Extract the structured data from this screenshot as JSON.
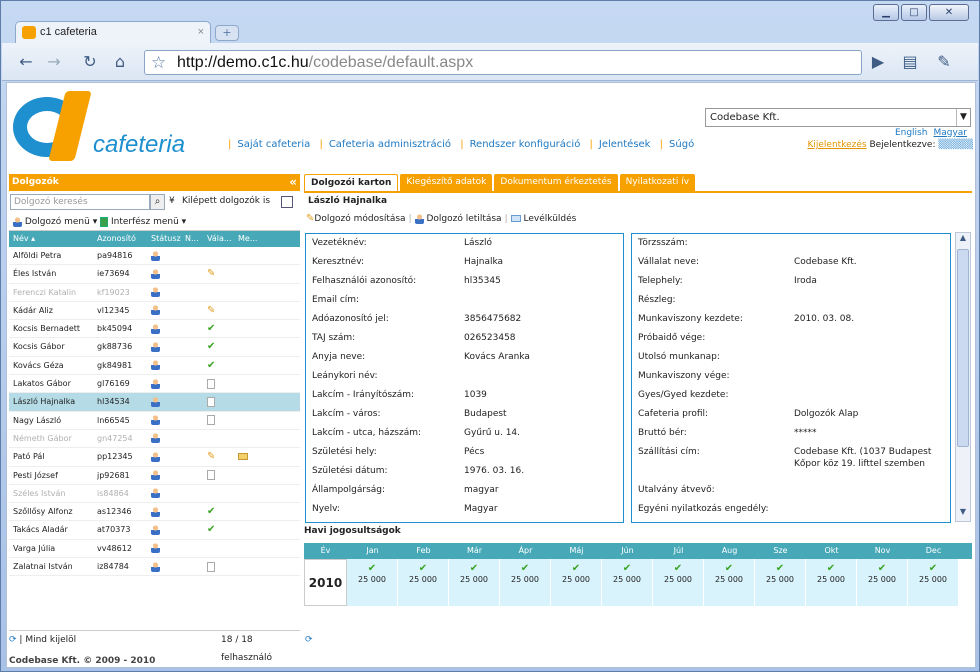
{
  "browser": {
    "tab_title": "c1 cafeteria",
    "tab_close": "×",
    "new_tab": "+",
    "url_host": "http://demo.c1c.hu",
    "url_path": "/codebase/default.aspx",
    "win_min": "▁",
    "win_max": "□",
    "win_close": "✕"
  },
  "header": {
    "brand": "cafeteria",
    "nav": [
      "Saját cafeteria",
      "Cafeteria adminisztráció",
      "Rendszer konfiguráció",
      "Jelentések",
      "Súgó"
    ],
    "company_select": "Codebase Kft.",
    "lang_en": "English",
    "lang_hu": "Magyar",
    "logout": "Kijelentkezés",
    "logged_in_label": "Bejelentkezve:",
    "logged_in_user": "▒▒▒▒▒"
  },
  "left": {
    "title": "Dolgozók",
    "collapse": "«",
    "search_placeholder": "Dolgozó keresés",
    "exited_label": "Kilépett dolgozók is",
    "menu1": "Dolgozó menü ▾",
    "menu2": "Interfész menü ▾",
    "columns": [
      "Név ▴",
      "Azonosító",
      "Státusz",
      "N...",
      "Vála...",
      "Me..."
    ],
    "rows": [
      {
        "name": "Alföldi Petra",
        "id": "pa94816",
        "st": "p",
        "vala": "",
        "me": "",
        "dim": false,
        "sel": false
      },
      {
        "name": "Éles István",
        "id": "ie73694",
        "st": "p",
        "vala": "pen",
        "me": "",
        "dim": false,
        "sel": false
      },
      {
        "name": "Ferenczi Katalin",
        "id": "kf19023",
        "st": "p",
        "vala": "",
        "me": "",
        "dim": true,
        "sel": false
      },
      {
        "name": "Kádár Aliz",
        "id": "vl12345",
        "st": "p",
        "vala": "pen",
        "me": "",
        "dim": false,
        "sel": false
      },
      {
        "name": "Kocsis Bernadett",
        "id": "bk45094",
        "st": "p",
        "vala": "check",
        "me": "",
        "dim": false,
        "sel": false
      },
      {
        "name": "Kocsis Gábor",
        "id": "gk88736",
        "st": "p",
        "vala": "check",
        "me": "",
        "dim": false,
        "sel": false
      },
      {
        "name": "Kovács Géza",
        "id": "gk84981",
        "st": "p",
        "vala": "check",
        "me": "",
        "dim": false,
        "sel": false
      },
      {
        "name": "Lakatos Gábor",
        "id": "gl76169",
        "st": "p",
        "vala": "doc",
        "me": "",
        "dim": false,
        "sel": false
      },
      {
        "name": "László Hajnalka",
        "id": "hl34534",
        "st": "p",
        "vala": "doc",
        "me": "",
        "dim": false,
        "sel": true
      },
      {
        "name": "Nagy László",
        "id": "ln66545",
        "st": "p",
        "vala": "doc",
        "me": "",
        "dim": false,
        "sel": false
      },
      {
        "name": "Németh Gábor",
        "id": "gn47254",
        "st": "p",
        "vala": "",
        "me": "",
        "dim": true,
        "sel": false
      },
      {
        "name": "Pató Pál",
        "id": "pp12345",
        "st": "p",
        "vala": "pen",
        "me": "env",
        "dim": false,
        "sel": false
      },
      {
        "name": "Pesti József",
        "id": "jp92681",
        "st": "p",
        "vala": "doc",
        "me": "",
        "dim": false,
        "sel": false
      },
      {
        "name": "Széles István",
        "id": "is84864",
        "st": "p",
        "vala": "",
        "me": "",
        "dim": true,
        "sel": false
      },
      {
        "name": "Szőllősy Alfonz",
        "id": "as12346",
        "st": "p",
        "vala": "check",
        "me": "",
        "dim": false,
        "sel": false
      },
      {
        "name": "Takács Aladár",
        "id": "at70373",
        "st": "p",
        "vala": "check",
        "me": "",
        "dim": false,
        "sel": false
      },
      {
        "name": "Varga Júlia",
        "id": "vv48612",
        "st": "p",
        "vala": "",
        "me": "",
        "dim": false,
        "sel": false
      },
      {
        "name": "Zalatnai István",
        "id": "iz84784",
        "st": "p",
        "vala": "doc",
        "me": "",
        "dim": false,
        "sel": false
      }
    ],
    "select_all": "Mind kijelöl",
    "count": "18 / 18 felhasználó",
    "copyright": "Codebase Kft. © 2009 - 2010"
  },
  "right": {
    "tabs": [
      "Dolgozói karton",
      "Kiegészítő adatok",
      "Dokumentum érkeztetés",
      "Nyilatkozati ív"
    ],
    "person": "László Hajnalka",
    "act1": "Dolgozó módosítása",
    "act2": "Dolgozó letiltása",
    "act3": "Levélküldés",
    "fields_left": [
      [
        "Vezetéknév:",
        "László"
      ],
      [
        "Keresztnév:",
        "Hajnalka"
      ],
      [
        "Felhasználói azonosító:",
        "hl35345"
      ],
      [
        "Email cím:",
        ""
      ],
      [
        "Adóazonosító jel:",
        "3856475682"
      ],
      [
        "TAJ szám:",
        "026523458"
      ],
      [
        "Anyja neve:",
        "Kovács Aranka"
      ],
      [
        "Leánykori név:",
        ""
      ],
      [
        "Lakcím - Irányítószám:",
        "1039"
      ],
      [
        "Lakcím - város:",
        "Budapest"
      ],
      [
        "Lakcím - utca, házszám:",
        "Gyűrű u. 14."
      ],
      [
        "Születési hely:",
        "Pécs"
      ],
      [
        "Születési dátum:",
        "1976. 03. 16."
      ],
      [
        "Állampolgárság:",
        "magyar"
      ],
      [
        "Nyelv:",
        "Magyar"
      ]
    ],
    "fields_right": [
      [
        "Törzsszám:",
        ""
      ],
      [
        "Vállalat neve:",
        "Codebase Kft."
      ],
      [
        "Telephely:",
        "Iroda"
      ],
      [
        "Részleg:",
        ""
      ],
      [
        "Munkaviszony kezdete:",
        "2010. 03. 08."
      ],
      [
        "Próbaidő vége:",
        ""
      ],
      [
        "Utolsó munkanap:",
        ""
      ],
      [
        "Munkaviszony vége:",
        ""
      ],
      [
        "Gyes/Gyed kezdete:",
        ""
      ],
      [
        "Cafeteria profil:",
        "Dolgozók Alap"
      ],
      [
        "Bruttó bér:",
        "*****"
      ],
      [
        "Szállítási cím:",
        "Codebase Kft. (1037 Budapest Kőpor köz 19. lifttel szemben"
      ],
      [
        "",
        ""
      ],
      [
        "Utalvány átvevő:",
        ""
      ],
      [
        "Egyéni nyilatkozás engedély:",
        ""
      ]
    ],
    "monthly_title": "Havi jogosultságok",
    "year_label": "Év",
    "months": [
      "Jan",
      "Feb",
      "Már",
      "Ápr",
      "Máj",
      "Jún",
      "Júl",
      "Aug",
      "Sze",
      "Okt",
      "Nov",
      "Dec"
    ],
    "year": "2010",
    "amount": "25 000"
  }
}
